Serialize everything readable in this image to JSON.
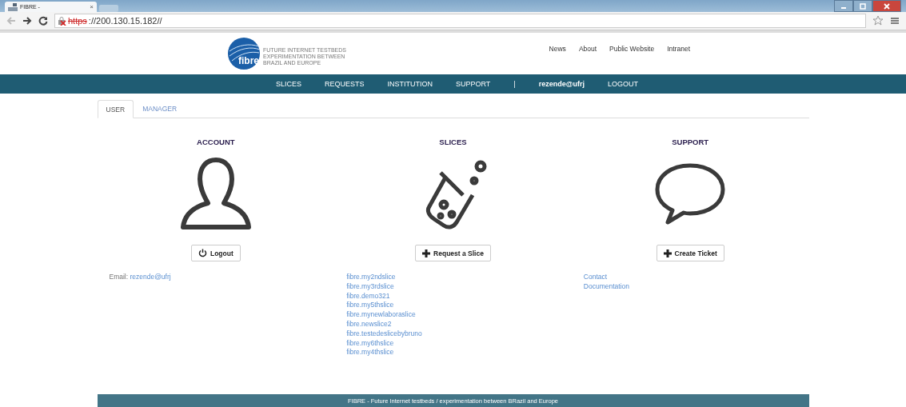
{
  "browser": {
    "tab_title": "FIBRE -",
    "tab_close": "×",
    "url_scheme": "https",
    "url_rest": "://200.130.15.182//",
    "insecure": true
  },
  "header": {
    "logo_text": "fibre",
    "tagline": [
      "FUTURE INTERNET TESTBEDS",
      "EXPERIMENTATION BETWEEN",
      "BRAZIL AND EUROPE"
    ],
    "links": [
      "News",
      "About",
      "Public Website",
      "Intranet"
    ]
  },
  "navbar": [
    {
      "label": "SLICES",
      "kind": "link"
    },
    {
      "label": "REQUESTS",
      "kind": "link"
    },
    {
      "label": "INSTITUTION",
      "kind": "link"
    },
    {
      "label": "SUPPORT",
      "kind": "link"
    },
    {
      "label": "|",
      "kind": "separator"
    },
    {
      "label": "rezende@ufrj",
      "kind": "user"
    },
    {
      "label": "LOGOUT",
      "kind": "link"
    }
  ],
  "tabs": [
    {
      "label": "USER",
      "selected": true
    },
    {
      "label": "MANAGER",
      "selected": false
    }
  ],
  "columns": [
    {
      "title": "ACCOUNT",
      "button": {
        "label": "Logout"
      },
      "kind": "email",
      "email_label": "Email:",
      "email": "rezende@ufrj"
    },
    {
      "title": "SLICES",
      "button": {
        "label": "Request a Slice"
      },
      "kind": "links",
      "links": [
        "fibre.my2ndslice",
        "fibre.my3rdslice",
        "fibre.demo321",
        "fibre.my5thslice",
        "fibre.mynewlaboraslice",
        "fibre.newslice2",
        "fibre.testedeslicebybruno",
        "fibre.my6thslice",
        "fibre.my4thslice"
      ]
    },
    {
      "title": "SUPPORT",
      "button": {
        "label": "Create Ticket"
      },
      "kind": "links",
      "links": [
        "Contact",
        "Documentation"
      ]
    }
  ],
  "footer": "FIBRE - Future Internet testbeds / experimentation between BRazil and Europe"
}
